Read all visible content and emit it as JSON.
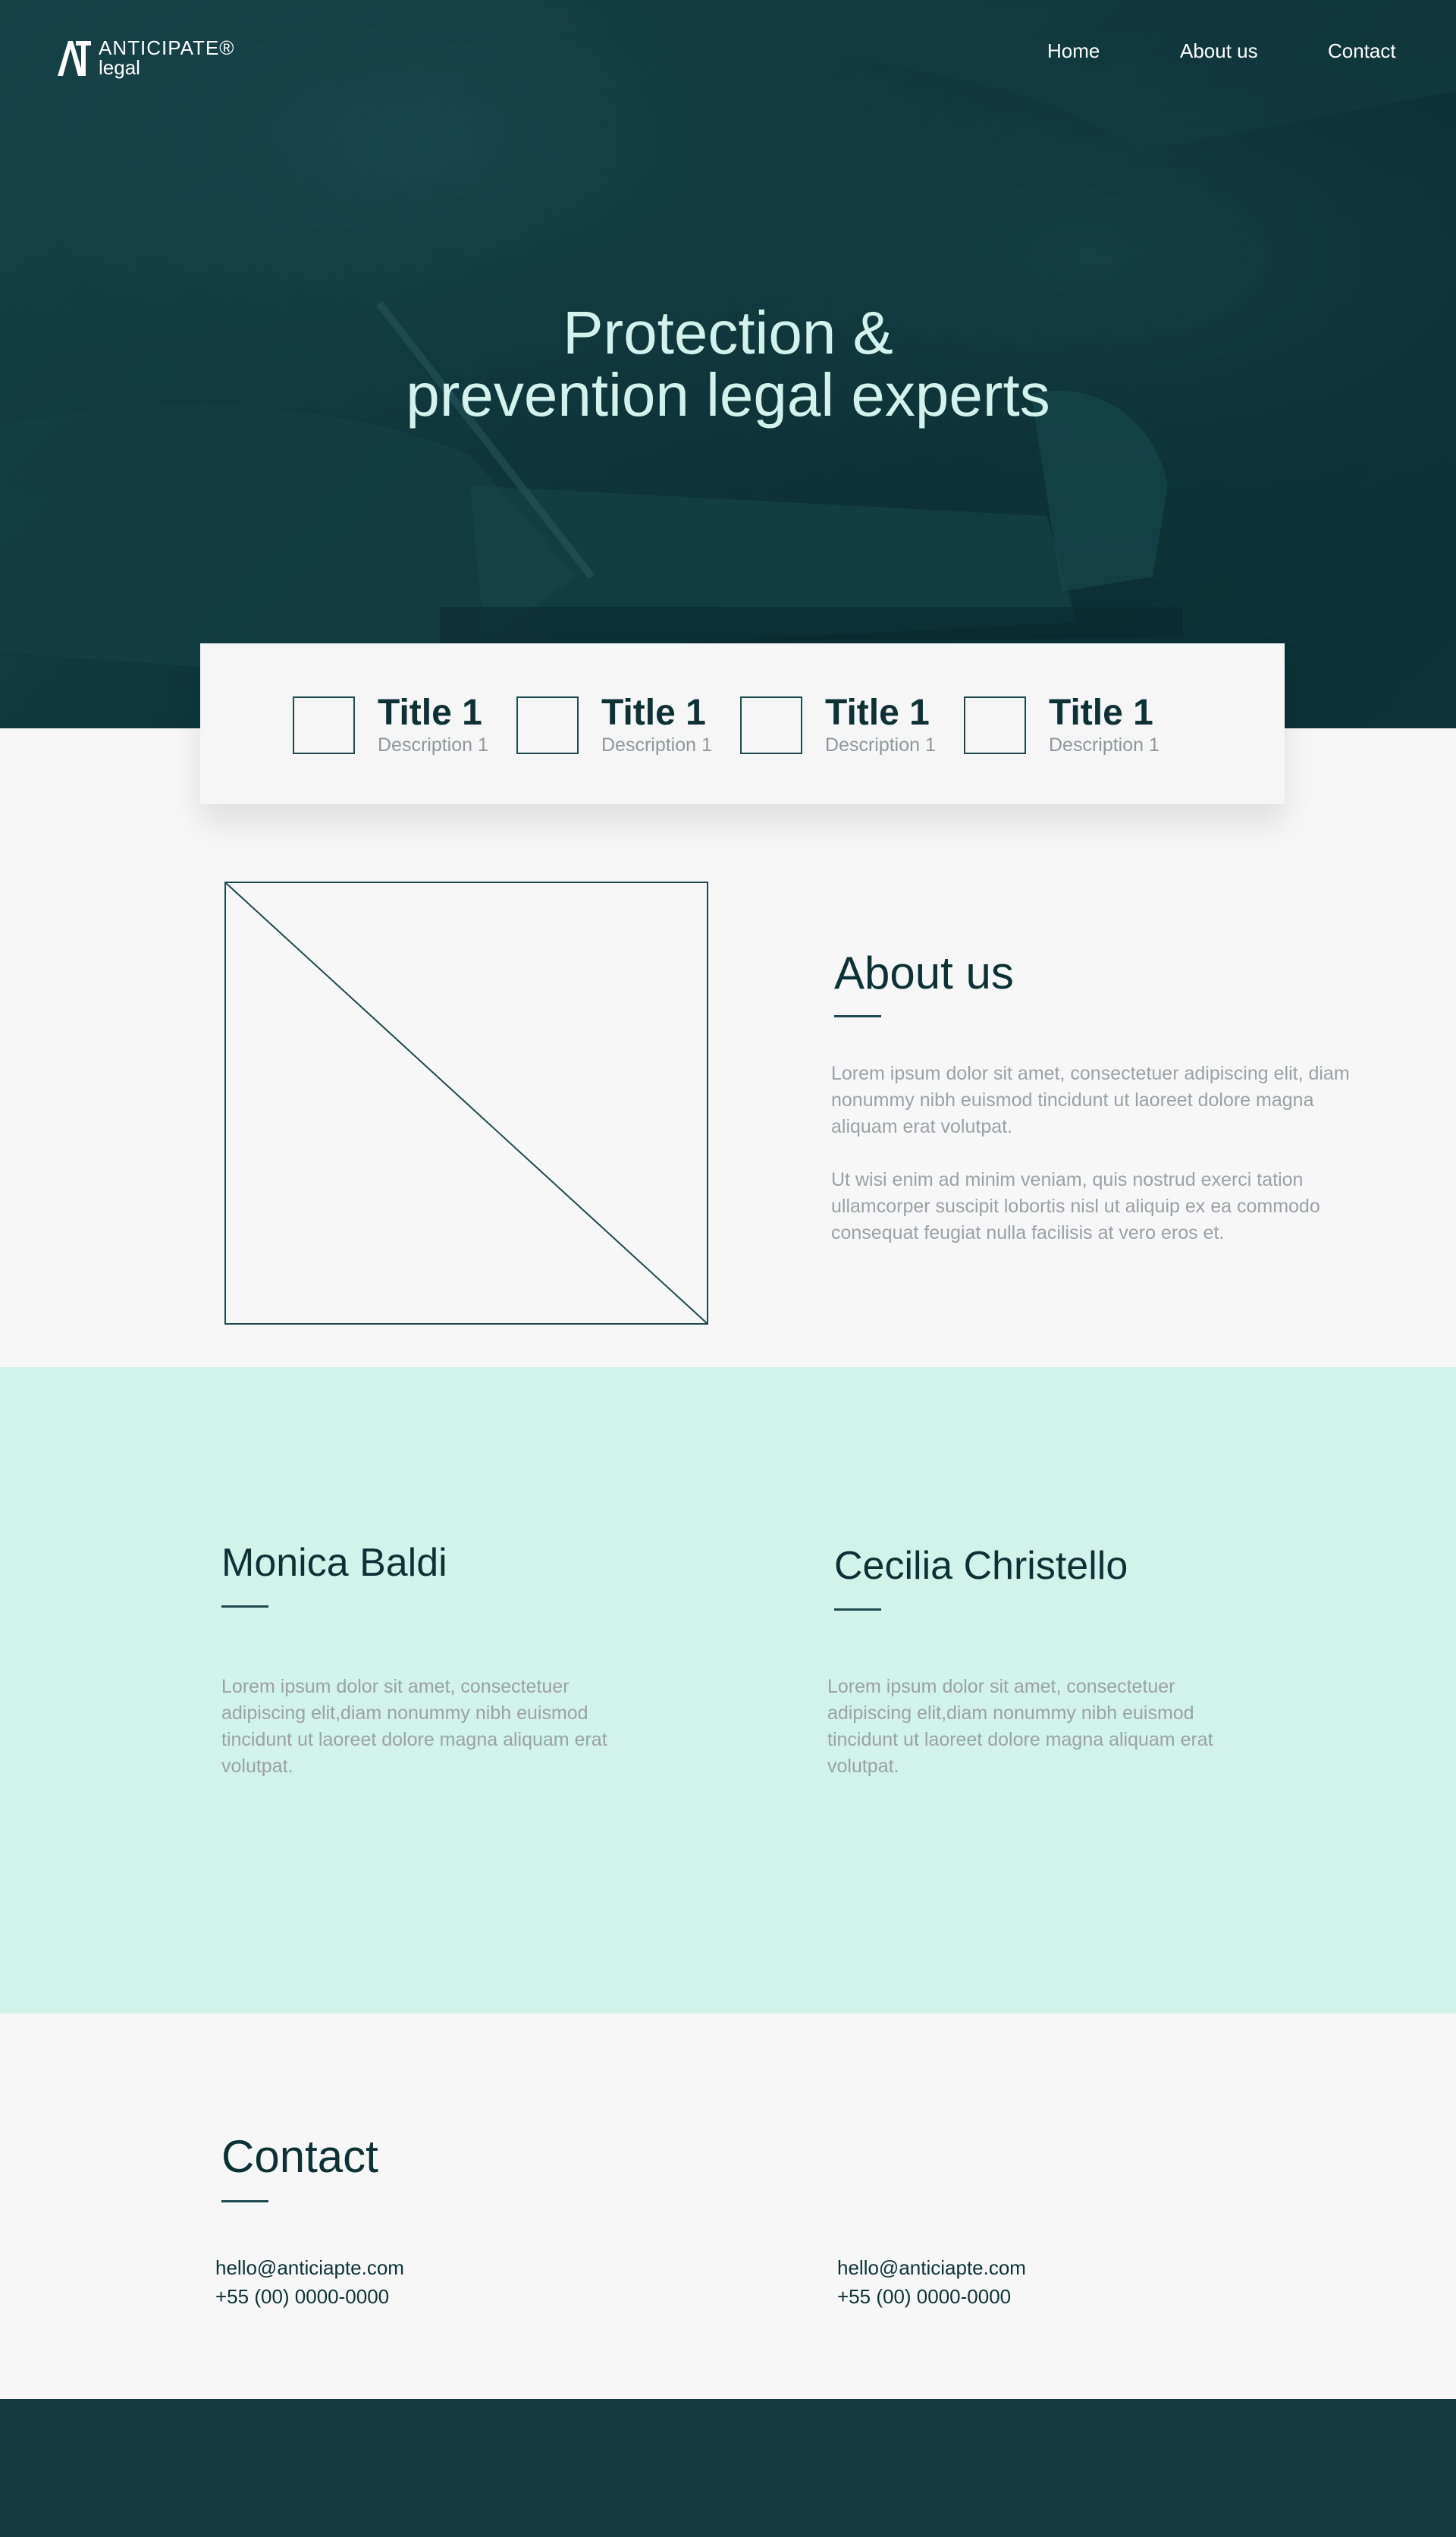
{
  "header": {
    "logo": {
      "line1": "ANTICIPATE®",
      "line2": "legal"
    },
    "nav": [
      {
        "label": "Home"
      },
      {
        "label": "About us"
      },
      {
        "label": "Contact"
      }
    ]
  },
  "hero": {
    "title_line1": "Protection &",
    "title_line2": "prevention legal experts"
  },
  "features": [
    {
      "title": "Title 1",
      "description": "Description 1"
    },
    {
      "title": "Title 1",
      "description": "Description 1"
    },
    {
      "title": "Title 1",
      "description": "Description 1"
    },
    {
      "title": "Title 1",
      "description": "Description 1"
    }
  ],
  "about": {
    "title": "About us",
    "paragraphs": [
      "Lorem ipsum dolor sit amet, consectetuer adipiscing elit, diam nonummy nibh euismod tincidunt ut laoreet dolore magna aliquam erat volutpat.",
      "Ut wisi enim ad minim veniam, quis nostrud exerci tation ullamcorper suscipit lobortis nisl ut aliquip ex ea commodo consequat feugiat nulla facilisis at vero eros et."
    ]
  },
  "team": [
    {
      "name": "Monica Baldi",
      "bio": "Lorem ipsum dolor sit amet, consectetuer adipiscing elit,diam nonummy nibh euismod tincidunt ut laoreet dolore magna aliquam erat volutpat."
    },
    {
      "name": "Cecilia Christello",
      "bio": "Lorem ipsum dolor sit amet, consectetuer adipiscing elit,diam nonummy nibh euismod tincidunt ut laoreet dolore magna aliquam erat volutpat."
    }
  ],
  "contact": {
    "title": "Contact",
    "columns": [
      {
        "email": "hello@anticiapte.com",
        "phone": "+55 (00) 0000-0000"
      },
      {
        "email": "hello@anticiapte.com",
        "phone": "+55 (00) 0000-0000"
      }
    ]
  },
  "colors": {
    "hero_bg": "#0f383c",
    "hero_title": "#d2f3ec",
    "accent_dark": "#0d3236",
    "team_bg": "#d1f3ea",
    "page_bg": "#f7f7f7",
    "footer_bg": "#153a3d",
    "muted_text": "#9aa2a4"
  }
}
